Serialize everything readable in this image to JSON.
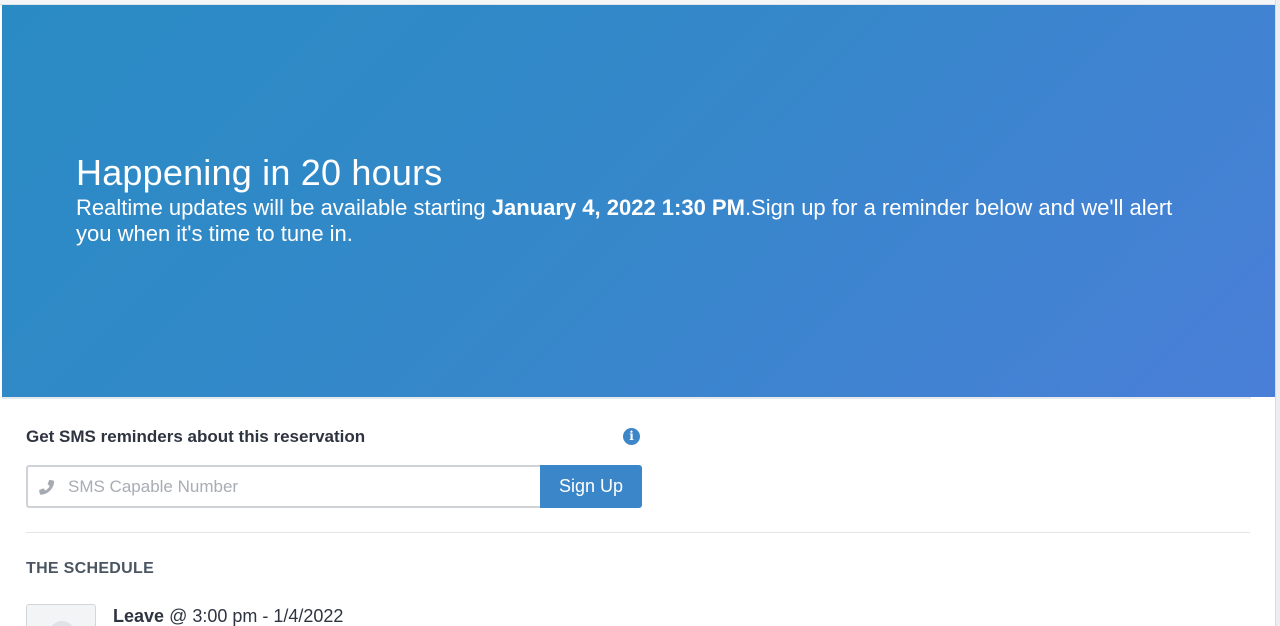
{
  "hero": {
    "title": "Happening in 20 hours",
    "desc_prefix": "Realtime updates will be available starting ",
    "desc_datetime": "January 4, 2022 1:30 PM",
    "desc_suffix": ".Sign up for a reminder below and we'll alert you when it's time to tune in.",
    "gradient_start": "#2a8bc4",
    "gradient_end": "#4a7fd8"
  },
  "sms": {
    "heading": "Get SMS reminders about this reservation",
    "info_icon": "info-icon",
    "phone_icon": "phone-icon",
    "input_placeholder": "SMS Capable Number",
    "input_value": "",
    "button_label": "Sign Up",
    "button_color": "#3a86c8"
  },
  "schedule": {
    "heading": "THE SCHEDULE",
    "items": [
      {
        "action": "Leave",
        "at": "@ 3:00 pm - 1/4/2022"
      }
    ]
  }
}
